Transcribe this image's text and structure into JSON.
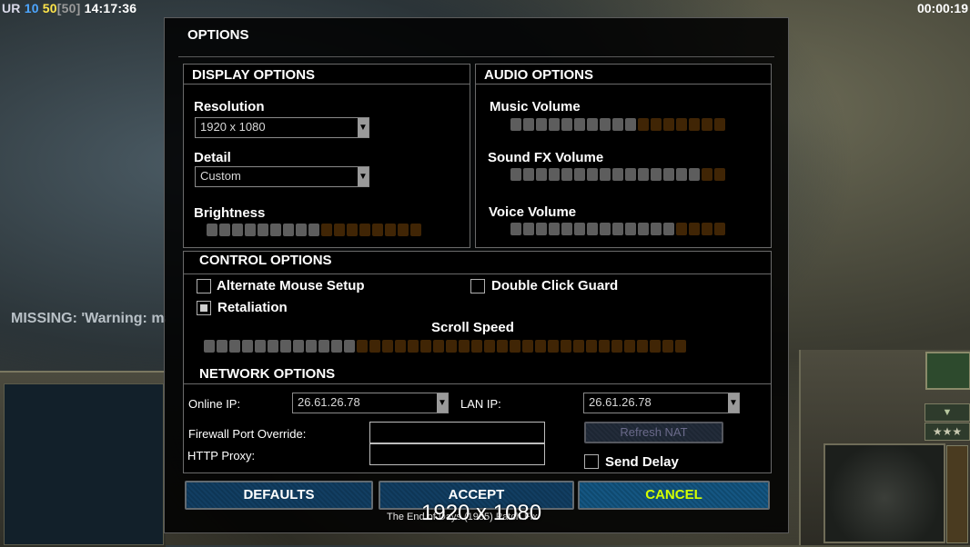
{
  "hud": {
    "player": "UR",
    "units": "10",
    "cap": "50",
    "cap_bracket": "[50]",
    "clock": "14:17:36",
    "timer": "00:00:19",
    "missing": "MISSING: 'Warning: ma"
  },
  "dialog": {
    "title": "OPTIONS"
  },
  "display": {
    "heading": "DISPLAY OPTIONS",
    "resolution_label": "Resolution",
    "resolution_value": "1920 x 1080",
    "detail_label": "Detail",
    "detail_value": "Custom",
    "brightness_label": "Brightness",
    "brightness": {
      "filled": 9,
      "total": 17
    }
  },
  "audio": {
    "heading": "AUDIO OPTIONS",
    "music_label": "Music Volume",
    "music": {
      "filled": 10,
      "total": 17
    },
    "sfx_label": "Sound FX Volume",
    "sfx": {
      "filled": 15,
      "total": 17
    },
    "voice_label": "Voice Volume",
    "voice": {
      "filled": 13,
      "total": 17
    }
  },
  "control": {
    "heading": "CONTROL OPTIONS",
    "alt_mouse_label": "Alternate Mouse Setup",
    "alt_mouse_checked": false,
    "double_click_label": "Double Click Guard",
    "double_click_checked": false,
    "retaliation_label": "Retaliation",
    "retaliation_checked": true,
    "scroll_label": "Scroll Speed",
    "scroll": {
      "filled": 12,
      "total": 38
    }
  },
  "network": {
    "heading": "NETWORK OPTIONS",
    "online_ip_label": "Online IP:",
    "online_ip_value": "26.61.26.78",
    "lan_ip_label": "LAN IP:",
    "lan_ip_value": "26.61.26.78",
    "firewall_label": "Firewall Port Override:",
    "firewall_value": "",
    "proxy_label": "HTTP Proxy:",
    "proxy_value": "",
    "refresh_nat_label": "Refresh NAT",
    "send_delay_label": "Send Delay",
    "send_delay_checked": false
  },
  "buttons": {
    "defaults": "DEFAULTS",
    "accept": "ACCEPT",
    "cancel": "CANCEL"
  },
  "overlay": {
    "resolution_text": "1920 x 1080",
    "footer_text": "The End of Days (1985) Patch Fix"
  },
  "side": {
    "arrow_glyph": "▼",
    "stars_glyph": "★★★"
  },
  "colors": {
    "slider_on": "#5d5d5d",
    "slider_off": "#402505",
    "cancel_text": "#d4ff00",
    "button_blue": "#0e3656"
  }
}
